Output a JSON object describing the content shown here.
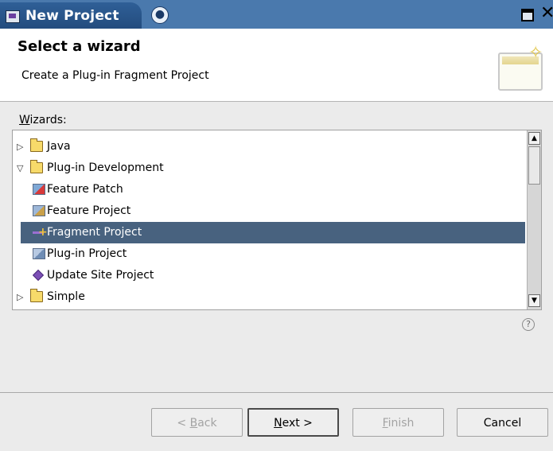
{
  "window": {
    "title": "New Project"
  },
  "header": {
    "title": "Select a wizard",
    "subtitle": "Create a Plug-in Fragment Project"
  },
  "wizards": {
    "label_mnemonic": "W",
    "label_rest": "izards:",
    "tree": [
      {
        "label": "Java",
        "level": 0,
        "expanded": false,
        "icon": "folder-icon"
      },
      {
        "label": "Plug-in Development",
        "level": 0,
        "expanded": true,
        "icon": "folder-icon"
      },
      {
        "label": "Feature Patch",
        "level": 1,
        "icon": "feature-patch-icon"
      },
      {
        "label": "Feature Project",
        "level": 1,
        "icon": "feature-project-icon"
      },
      {
        "label": "Fragment Project",
        "level": 1,
        "icon": "fragment-project-icon",
        "selected": true
      },
      {
        "label": "Plug-in Project",
        "level": 1,
        "icon": "plugin-project-icon"
      },
      {
        "label": "Update Site Project",
        "level": 1,
        "icon": "update-site-project-icon"
      },
      {
        "label": "Simple",
        "level": 0,
        "expanded": false,
        "icon": "folder-icon"
      }
    ]
  },
  "buttons": {
    "back": {
      "pre": "< ",
      "mnemonic": "B",
      "rest": "ack"
    },
    "next": {
      "mnemonic": "N",
      "rest": "ext >"
    },
    "finish": {
      "mnemonic": "F",
      "rest": "inish"
    },
    "cancel": {
      "label": "Cancel"
    }
  },
  "colors": {
    "selection": "#48627f",
    "titlebar": "#2f5f97"
  }
}
